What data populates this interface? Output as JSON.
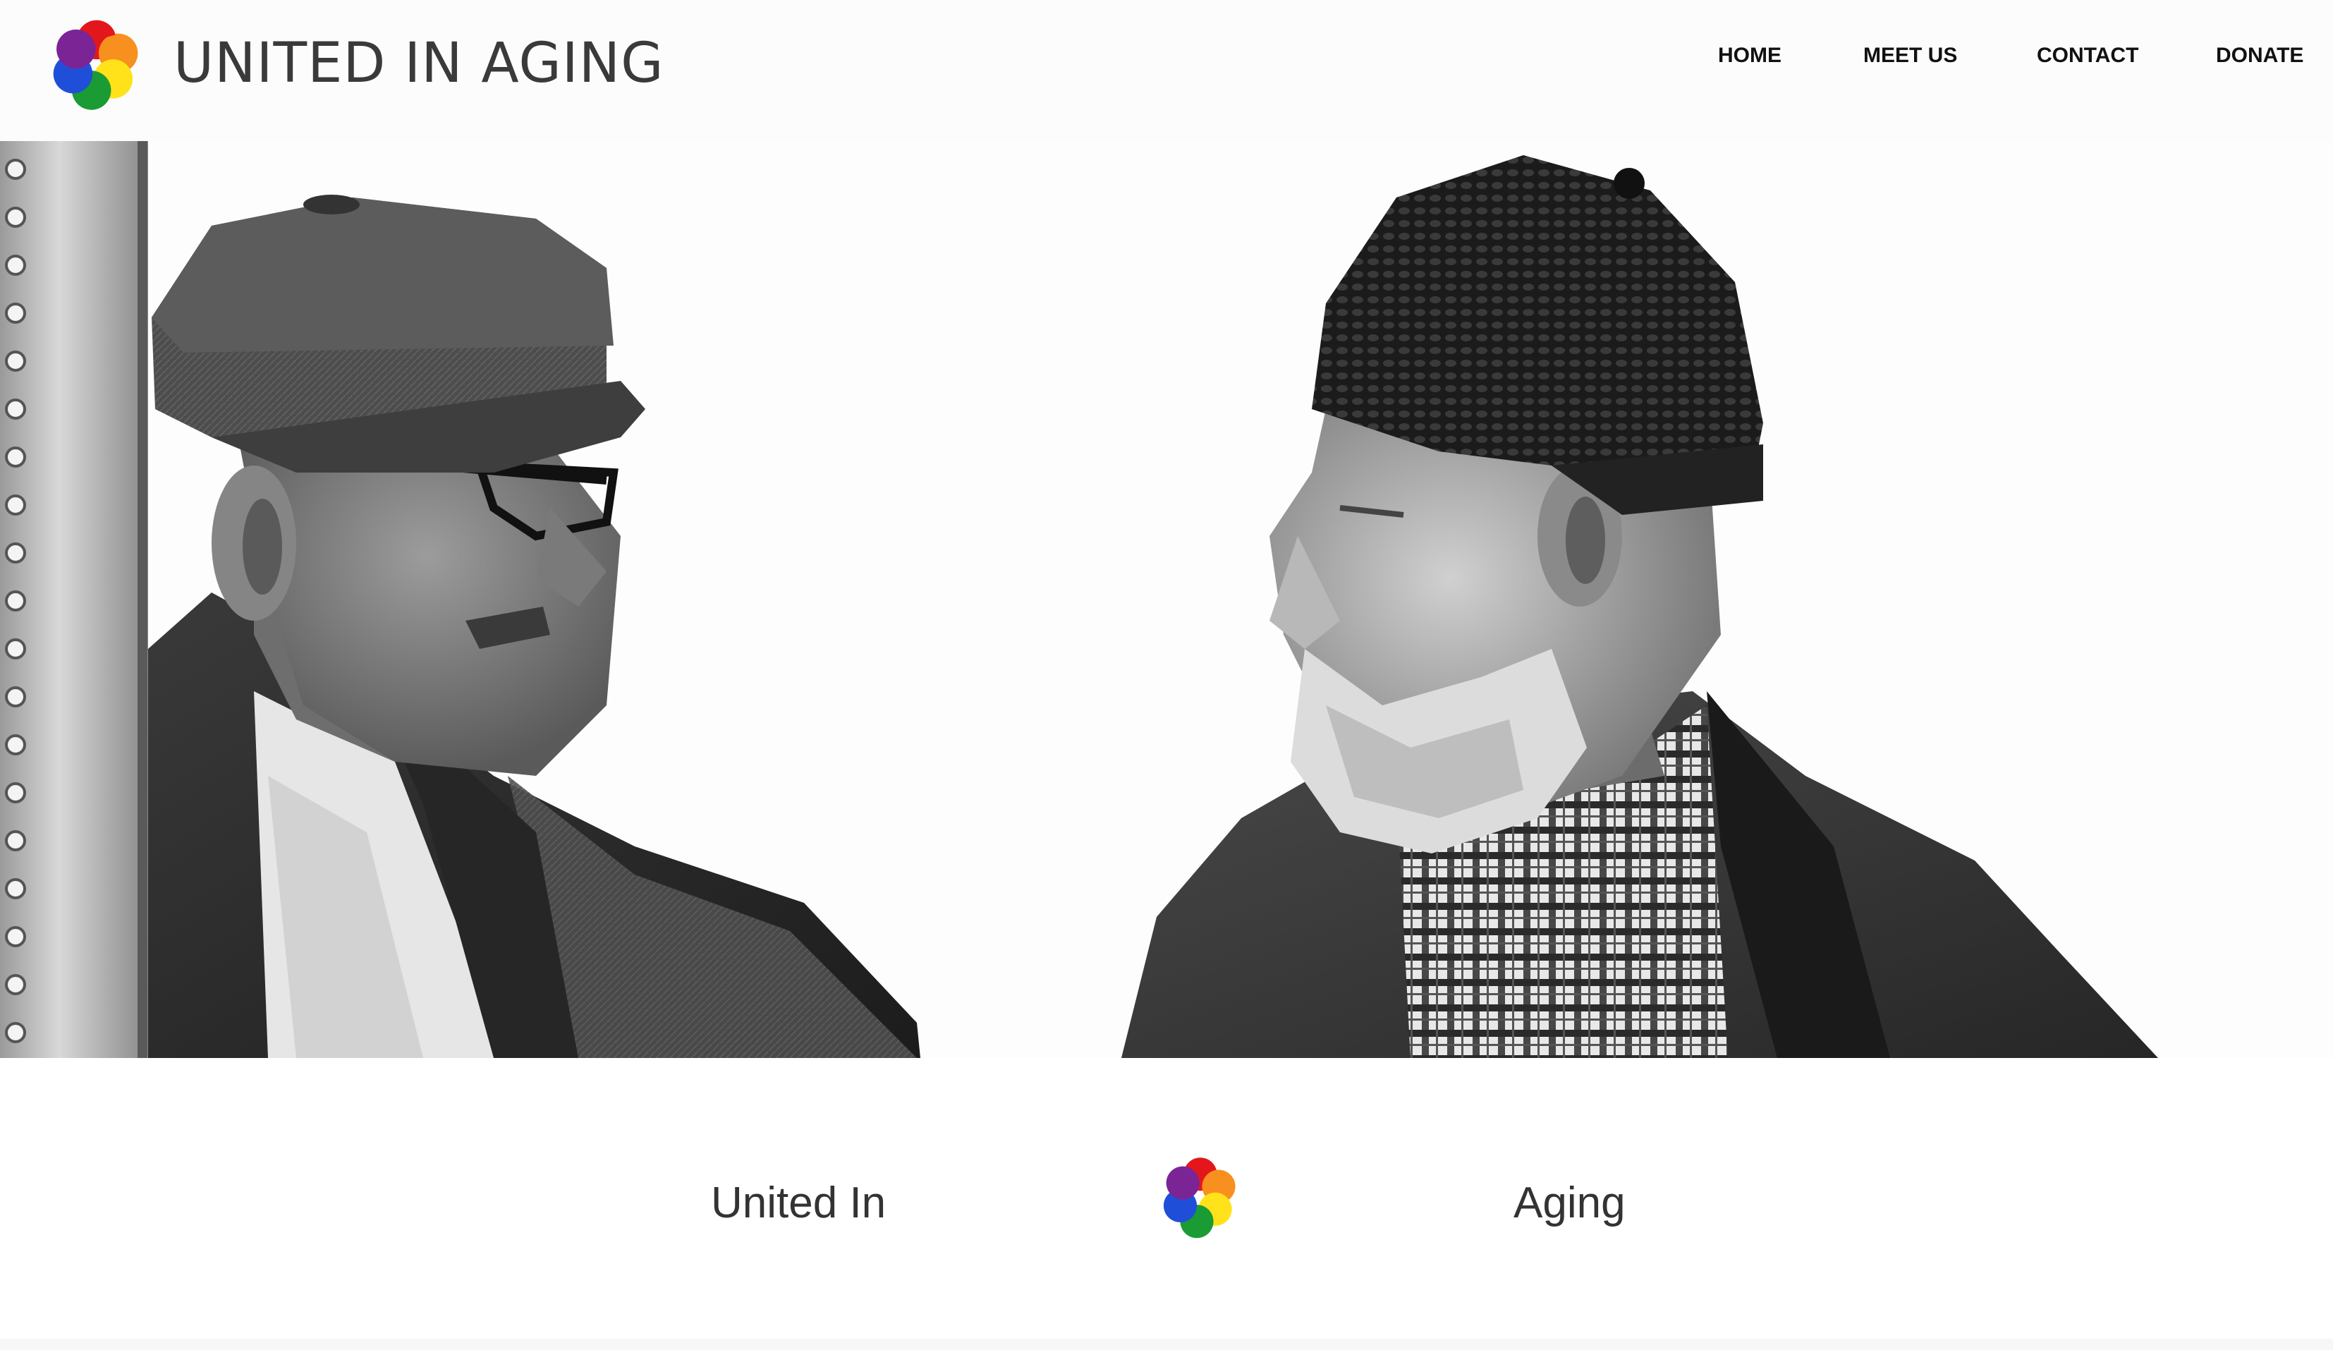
{
  "brand": {
    "name": "UNITED IN AGING",
    "logo_icon": "rainbow-flower-logo-icon"
  },
  "nav": {
    "items": [
      {
        "label": "HOME"
      },
      {
        "label": "MEET US"
      },
      {
        "label": "CONTACT"
      },
      {
        "label": "DONATE"
      }
    ]
  },
  "hero": {
    "image_subject": "two-elderly-men-photo"
  },
  "tagline": {
    "left_text": "United In",
    "right_text": "Aging",
    "logo_icon": "rainbow-flower-logo-icon"
  },
  "colors": {
    "petal_red": "#e3171b",
    "petal_orange": "#f7901e",
    "petal_yellow": "#ffe21a",
    "petal_green": "#1a9b34",
    "petal_blue": "#1f4fd8",
    "petal_purple": "#7b2496"
  }
}
